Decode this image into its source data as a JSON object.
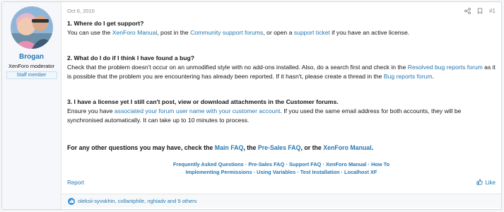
{
  "author": {
    "name": "Brogan",
    "title": "XenForo moderator",
    "banner": "Staff member"
  },
  "post": {
    "date": "Oct 6, 2010",
    "post_number": "#1",
    "q1": {
      "heading": "1. Where do I get support?",
      "t1": "You can use the ",
      "l1": "XenForo Manual",
      "t2": ", post in the ",
      "l2": "Community support forums",
      "t3": ", or open a ",
      "l3": "support ticket",
      "t4": " if you have an active license."
    },
    "q2": {
      "heading": "2. What do I do if I think I have found a bug?",
      "t1": "Check that the problem doesn't occur on an unmodified style with no add-ons installed. Also, do a search first and check in the ",
      "l1": "Resolved bug reports forum",
      "t2": " as it is possible that the problem you are encountering has already been reported. If it hasn't, please create a thread in the ",
      "l2": "Bug reports forum",
      "t3": "."
    },
    "q3": {
      "heading": "3. I have a license yet I still can't post, view or download attachments in the Customer forums.",
      "t1": "Ensure you have ",
      "l1": "associated your forum user name with your customer account",
      "t2": ". If you used the same email address for both accounts, they will be synchronised automatically. It can take up to 10 minutes to process."
    },
    "final": {
      "t1": "For any other questions you may have, check the ",
      "l1": "Main FAQ",
      "t2": ", the ",
      "l2": "Pre-Sales FAQ",
      "t3": ", or the ",
      "l3": "XenForo Manual",
      "t4": "."
    },
    "links_row1": "Frequently Asked Questions · Pre-Sales FAQ · Support FAQ · XenForo Manual · How To",
    "links_row2": "Implementing Permissions · Using Variables · Test Installation · Localhost XF"
  },
  "footer": {
    "report": "Report",
    "like": "Like"
  },
  "reactions": {
    "summary": "oleksii-syvokhin, collantphile, nghiadv and 9 others"
  },
  "icons": {
    "share": "share-icon",
    "bookmark": "bookmark-icon",
    "like": "thumbs-up-icon",
    "reaction": "like-reaction-icon"
  },
  "colors": {
    "link": "#2577b1",
    "reaction": "#3c8fd6"
  }
}
